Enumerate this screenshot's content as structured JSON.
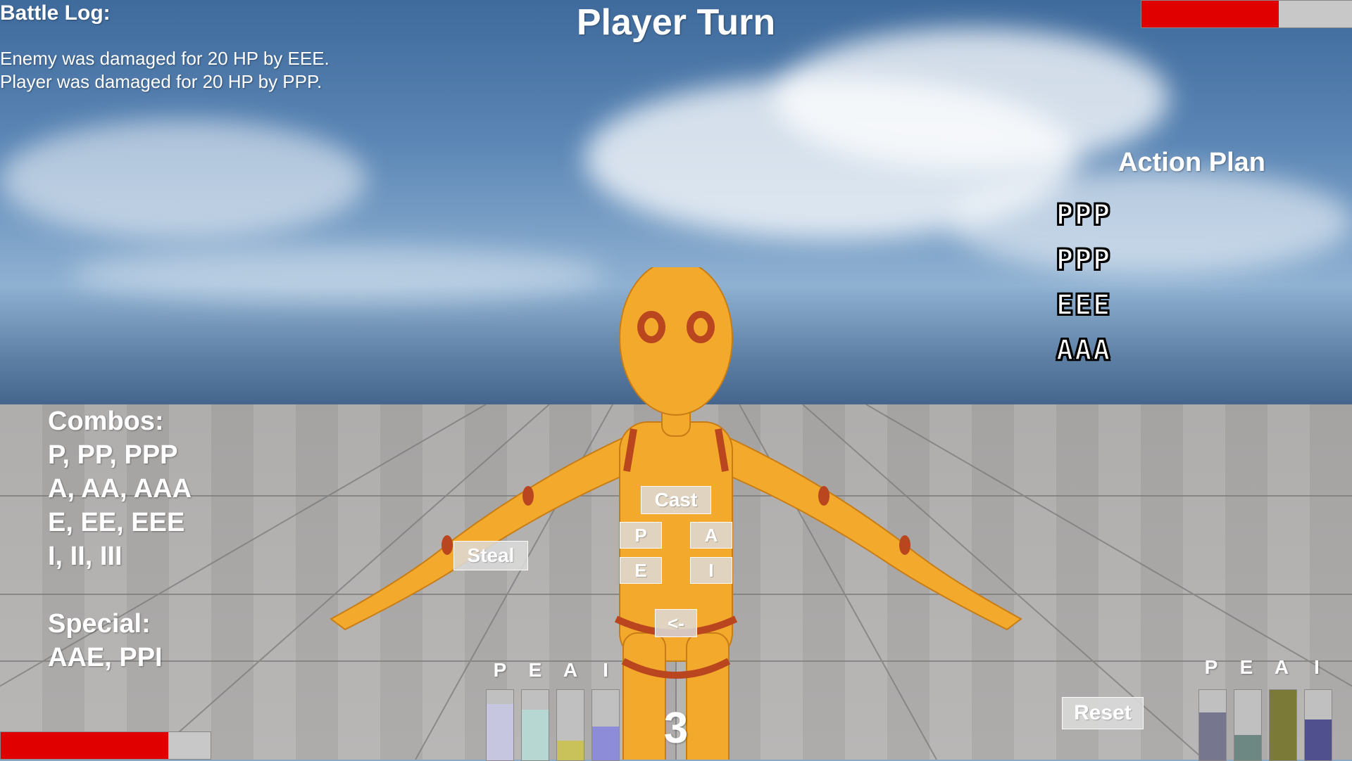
{
  "battle_log": {
    "title": "Battle Log:",
    "lines": [
      "Enemy was damaged for 20 HP by EEE.",
      "Player was damaged for 20 HP by PPP."
    ]
  },
  "turn_title": "Player Turn",
  "enemy_hp": {
    "fraction": 0.65
  },
  "player_hp": {
    "fraction": 0.8
  },
  "action_plan": {
    "title": "Action Plan",
    "items": [
      "PPP",
      "PPP",
      "EEE",
      "AAA"
    ]
  },
  "combos": {
    "title": "Combos:",
    "lines": [
      "P, PP, PPP",
      "A, AA, AAA",
      "E, EE, EEE",
      "I, II, III"
    ],
    "special_title": "Special:",
    "special_line": "AAE, PPI"
  },
  "buttons": {
    "cast": "Cast",
    "steal": "Steal",
    "p": "P",
    "a": "A",
    "e": "E",
    "i": "I",
    "back": "<-",
    "reset": "Reset"
  },
  "player_meters": {
    "labels": [
      "P",
      "E",
      "A",
      "I"
    ],
    "levels": [
      0.8,
      0.72,
      0.28,
      0.48
    ],
    "colors": [
      "#c7c6e0",
      "#b7d7d2",
      "#c9c15a",
      "#8c8cd8"
    ]
  },
  "enemy_meters": {
    "labels": [
      "P",
      "E",
      "A",
      "I"
    ],
    "levels": [
      0.68,
      0.36,
      1.0,
      0.58
    ],
    "colors": [
      "#76778e",
      "#6d8782",
      "#7b7a36",
      "#50508f"
    ]
  },
  "counter": "3",
  "colors": {
    "hp_fill": "#e00000",
    "hp_empty": "#c8c8c8",
    "character": "#f3a92b",
    "character_accent": "#b9461f"
  }
}
